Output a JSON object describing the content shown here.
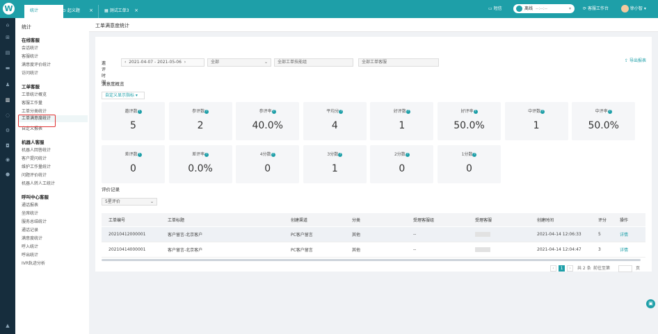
{
  "topbar": {
    "logo": "W",
    "tabs": [
      {
        "label": "统计",
        "active": true
      },
      {
        "label": "⊙ 起义题",
        "active": false
      },
      {
        "label": "▦ 测试工单3",
        "active": false
      }
    ],
    "close": "×",
    "sms": "短信",
    "status_label": "离线",
    "status_time": "--:--:--",
    "workbench": "客服工作台",
    "user": "徐小智"
  },
  "nav": {
    "title": "统计",
    "groups": [
      {
        "label": "在线客服",
        "items": [
          "会话统计",
          "客服统计",
          "满意度评价统计",
          "访问统计"
        ]
      },
      {
        "label": "工单客服",
        "items": [
          "工单统计概览",
          "客服工作量",
          "工单分类统计",
          "工单满意度统计",
          "自定义报表"
        ]
      },
      {
        "label": "机器人客服",
        "items": [
          "机器人回答统计",
          "客户提问统计",
          "维护工作量统计",
          "问题评价统计",
          "机器人转人工统计"
        ]
      },
      {
        "label": "呼叫中心客服",
        "items": [
          "通话报表",
          "坐席统计",
          "服务总结统计",
          "通话记录",
          "满意度统计",
          "呼入统计",
          "呼出统计",
          "IVR轨迹分析"
        ]
      }
    ]
  },
  "page": {
    "title": "工单满意度统计",
    "filter_label": "邀评时间",
    "date_range": "2021-04-07 - 2021-05-06",
    "scope": "全部",
    "group_placeholder": "全部工单技能组",
    "agent_placeholder": "全部工单客服",
    "export": "导出报表"
  },
  "overview": {
    "title": "满意度概览",
    "custom_btn": "自定义显示指标 ▾",
    "row1": [
      {
        "label": "邀评数",
        "value": "5"
      },
      {
        "label": "参评数",
        "value": "2"
      },
      {
        "label": "参评率",
        "value": "40.0%"
      },
      {
        "label": "平均分",
        "value": "4"
      },
      {
        "label": "好评数",
        "value": "1"
      },
      {
        "label": "好评率",
        "value": "50.0%"
      },
      {
        "label": "中评数",
        "value": "1"
      },
      {
        "label": "中评率",
        "value": "50.0%"
      }
    ],
    "row2": [
      {
        "label": "差评数",
        "value": "0"
      },
      {
        "label": "差评率",
        "value": "0.0%"
      },
      {
        "label": "4分数",
        "value": "0"
      },
      {
        "label": "3分数",
        "value": "1"
      },
      {
        "label": "2分数",
        "value": "0"
      },
      {
        "label": "1分数",
        "value": "0"
      }
    ]
  },
  "records": {
    "title": "评价记录",
    "filter": "5星评价",
    "columns": [
      "工单编号",
      "工单标题",
      "创建渠道",
      "分类",
      "受理客服组",
      "受理客服",
      "创建时间",
      "评分",
      "操作"
    ],
    "rows": [
      [
        "20210412000001",
        "客户留言-北京客户",
        "PC客户留言",
        "其他",
        "--",
        "",
        "2021-04-14 12:06:33",
        "5",
        "详情"
      ],
      [
        "20210414000001",
        "客户留言-北京客户",
        "PC客户留言",
        "其他",
        "--",
        "",
        "2021-04-14 12:04:47",
        "3",
        "详情"
      ]
    ]
  },
  "pager": {
    "prev": "‹",
    "current": "1",
    "next": "›",
    "total": "共 2 条",
    "goto": "前往至第",
    "page_unit": "页"
  }
}
